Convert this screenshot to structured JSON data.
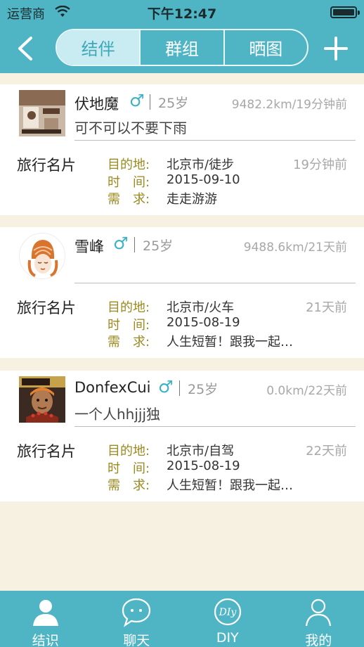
{
  "status_bar": {
    "carrier": "运营商",
    "time": "下午12:47"
  },
  "nav": {
    "tabs": [
      {
        "label": "结伴",
        "active": true
      },
      {
        "label": "群组",
        "active": false
      },
      {
        "label": "晒图",
        "active": false
      }
    ]
  },
  "card_section_title": "旅行名片",
  "labels": {
    "dest": "目的地:",
    "time": "时　间:",
    "need": "需　求:"
  },
  "posts": [
    {
      "username": "伏地魔",
      "gender": "♂",
      "age": "25岁",
      "distance_time": "9482.2km/19分钟前",
      "signature": "可不可以不要下雨",
      "card": {
        "dest": "北京市/徒步",
        "time": "2015-09-10",
        "need": "走走游游",
        "ago": "19分钟前"
      }
    },
    {
      "username": "雪峰",
      "gender": "♂",
      "age": "25岁",
      "distance_time": "9488.6km/21天前",
      "signature": "",
      "card": {
        "dest": "北京市/火车",
        "time": "2015-08-19",
        "need": "人生短暂！跟我一起…",
        "ago": "21天前"
      }
    },
    {
      "username": "DonfexCui",
      "gender": "♂",
      "age": "25岁",
      "distance_time": "0.0km/22天前",
      "signature": "一个人hhjjj独",
      "card": {
        "dest": "北京市/自驾",
        "time": "2015-08-19",
        "need": "人生短暂！跟我一起…",
        "ago": "22天前"
      }
    }
  ],
  "tabbar": [
    {
      "label": "结识",
      "icon": "person-icon",
      "active": true
    },
    {
      "label": "聊天",
      "icon": "chat-bubble-icon",
      "active": false
    },
    {
      "label": "DIY",
      "icon": "diy-icon",
      "active": false
    },
    {
      "label": "我的",
      "icon": "profile-outline-icon",
      "active": false
    }
  ],
  "colors": {
    "header": "#4fb5c5",
    "background": "#f7f1e1",
    "accent": "#3ab2c4",
    "label_olive": "#9a8a1e"
  }
}
